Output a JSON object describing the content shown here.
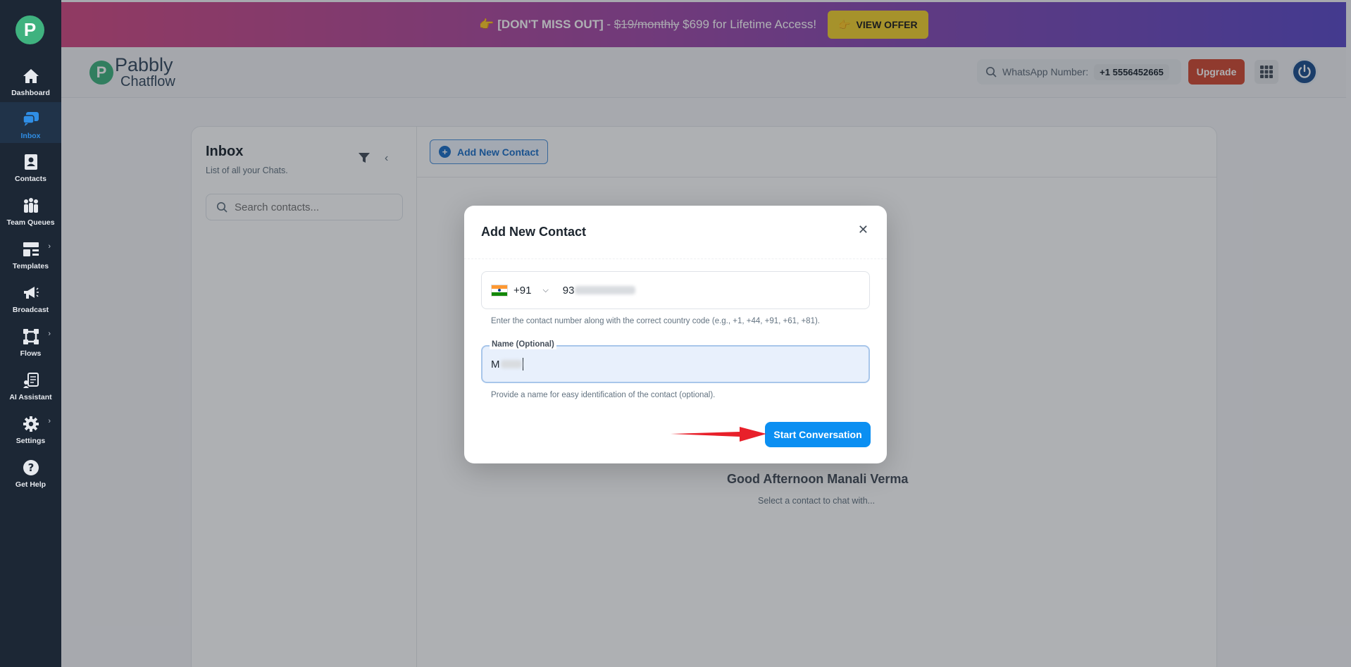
{
  "sidebar": {
    "logo": "P",
    "items": [
      {
        "label": "Dashboard",
        "icon": "home-icon"
      },
      {
        "label": "Inbox",
        "icon": "chat-icon",
        "active": true
      },
      {
        "label": "Contacts",
        "icon": "contact-book-icon"
      },
      {
        "label": "Team Queues",
        "icon": "team-icon"
      },
      {
        "label": "Templates",
        "icon": "templates-icon",
        "has_submenu": true
      },
      {
        "label": "Broadcast",
        "icon": "megaphone-icon"
      },
      {
        "label": "Flows",
        "icon": "flows-icon",
        "has_submenu": true
      },
      {
        "label": "AI Assistant",
        "icon": "ai-assistant-icon"
      },
      {
        "label": "Settings",
        "icon": "gear-icon",
        "has_submenu": true
      },
      {
        "label": "Get Help",
        "icon": "help-icon"
      }
    ]
  },
  "banner": {
    "emoji": "👉",
    "highlight": "[DON'T MISS OUT]",
    "dash": " - ",
    "old_price": "$19/monthly",
    "new_price_text": " $699 for Lifetime Access!",
    "button_label": "VIEW OFFER",
    "button_emoji": "👉"
  },
  "header": {
    "brand_word1": "Pabbly",
    "brand_word2": "Chatflow",
    "whatsapp_label": "WhatsApp Number:",
    "whatsapp_number": "+1 5556452665",
    "upgrade_label": "Upgrade"
  },
  "inbox": {
    "title": "Inbox",
    "subtitle": "List of all your Chats.",
    "search_placeholder": "Search contacts...",
    "add_contact_label": "Add New Contact",
    "greeting": "Good Afternoon Manali Verma",
    "greeting_sub": "Select a contact to chat with..."
  },
  "modal": {
    "title": "Add New Contact",
    "country_code": "+91",
    "phone_prefix": "93",
    "phone_helper": "Enter the contact number along with the correct country code (e.g., +1, +44, +91, +61, +81).",
    "name_label": "Name (Optional)",
    "name_prefix": "M",
    "name_helper": "Provide a name for easy identification of the contact (optional).",
    "start_button": "Start Conversation"
  },
  "colors": {
    "sidebar_bg": "#1c2735",
    "accent": "#0b8ff2",
    "upgrade": "#d24a33",
    "offer": "#f3d12f",
    "brand_green": "#3fb27f",
    "annotation_arrow": "#e8202a"
  }
}
